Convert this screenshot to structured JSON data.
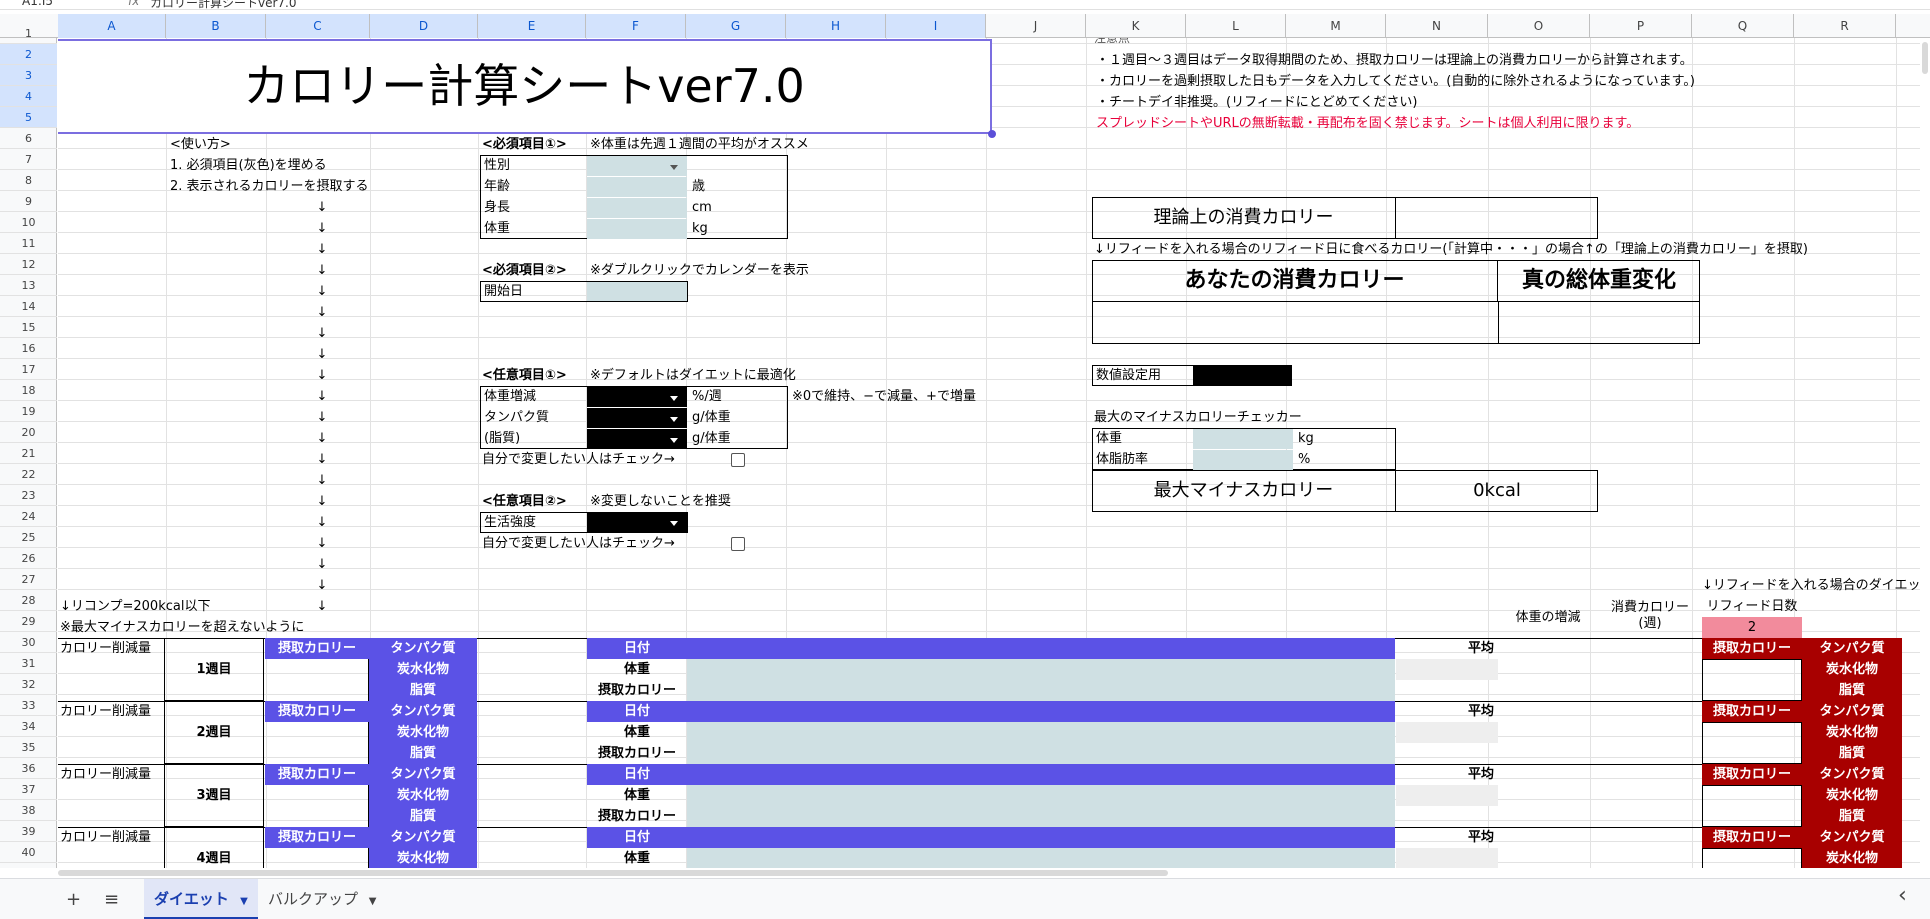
{
  "formula_bar": {
    "cell_ref": "A1:I5",
    "fx": "fx",
    "content": "カロリー計算シートver7.0"
  },
  "columns": [
    "A",
    "B",
    "C",
    "D",
    "E",
    "F",
    "G",
    "H",
    "I",
    "J",
    "K",
    "L",
    "M",
    "N",
    "O",
    "P",
    "Q",
    "R"
  ],
  "rows": [
    "1",
    "2",
    "3",
    "4",
    "5",
    "6",
    "7",
    "8",
    "9",
    "10",
    "11",
    "12",
    "13",
    "14",
    "15",
    "16",
    "17",
    "18",
    "19",
    "20",
    "21",
    "22",
    "23",
    "24",
    "25",
    "26",
    "27",
    "28",
    "29",
    "30",
    "31",
    "32",
    "33",
    "34",
    "35",
    "36",
    "37",
    "38",
    "39",
    "40"
  ],
  "title": "カロリー計算シートver7.0",
  "notes": {
    "header": "注意点",
    "line1": "・１週目〜３週目はデータ取得期間のため、摂取カロリーは理論上の消費カロリーから計算されます。",
    "line2": "・カロリーを過剰摂取した日もデータを入力してください。(自動的に除外されるようになっています。)",
    "line3": "・チートデイ非推奨。(リフィードにとどめてください)",
    "warning": "スプレッドシートやURLの無断転載・再配布を固く禁じます。シートは個人利用に限ります。"
  },
  "howto": {
    "header": "<使い方>",
    "step1": "1. 必須項目(灰色)を埋める",
    "step2": "2. 表示されるカロリーを摂取する",
    "arrow": "↓"
  },
  "required1": {
    "header": "<必須項目①>",
    "note": "※体重は先週１週間の平均がオススメ",
    "gender": "性別",
    "age": "年齢",
    "age_unit": "歳",
    "height": "身長",
    "height_unit": "cm",
    "weight": "体重",
    "weight_unit": "kg"
  },
  "required2": {
    "header": "<必須項目②>",
    "note": "※ダブルクリックでカレンダーを表示",
    "start_date": "開始日"
  },
  "optional1": {
    "header": "<任意項目①>",
    "note": "※デフォルトはダイエットに最適化",
    "weight_change": "体重増減",
    "weight_change_unit": "%/週",
    "weight_change_note": "※0で維持、−で減量、+で増量",
    "protein": "タンパク質",
    "protein_unit": "g/体重",
    "fat": "(脂質)",
    "fat_unit": "g/体重",
    "check_label": "自分で変更したい人はチェック→"
  },
  "optional2": {
    "header": "<任意項目②>",
    "note": "※変更しないことを推奨",
    "activity": "生活強度",
    "check_label": "自分で変更したい人はチェック→"
  },
  "theory_calorie": "理論上の消費カロリー",
  "refeed_note": "↓リフィードを入れる場合のリフィード日に食べるカロリー(「計算中・・・」の場合↑の「理論上の消費カロリー」を摂取)",
  "your_calorie": "あなたの消費カロリー",
  "true_weight": "真の総体重変化",
  "numeric_setting": "数値設定用",
  "checker": {
    "header": "最大のマイナスカロリーチェッカー",
    "weight": "体重",
    "weight_unit": "kg",
    "bodyfat": "体脂肪率",
    "bodyfat_unit": "%",
    "max_label": "最大マイナスカロリー",
    "max_value": "0kcal"
  },
  "recomp_note": "↓リコンプ=200kcal以下",
  "max_note": "※最大マイナスカロリーを超えないように",
  "refeed_diet_note": "↓リフィードを入れる場合のダイエッ",
  "col_headers": {
    "weight_change": "体重の増減",
    "consumption_l1": "消費カロリー",
    "consumption_l2": "(週)",
    "refeed_days": "リフィード日数",
    "refeed_days_value": "2"
  },
  "weeks": [
    {
      "deficit": "カロリー削減量",
      "label": "1週目"
    },
    {
      "deficit": "カロリー削減量",
      "label": "2週目"
    },
    {
      "deficit": "カロリー削減量",
      "label": "3週目"
    },
    {
      "deficit": "カロリー削減量",
      "label": "4週目"
    }
  ],
  "macro": {
    "intake": "摂取カロリー",
    "protein": "タンパク質",
    "carbs": "炭水化物",
    "fat": "脂質"
  },
  "daily": {
    "date": "日付",
    "weight": "体重",
    "intake": "摂取カロリー",
    "average": "平均"
  },
  "tabs": {
    "add": "+",
    "menu": "≡",
    "diet": "ダイエット",
    "bulk": "バルクアップ",
    "nav_left": "‹"
  }
}
